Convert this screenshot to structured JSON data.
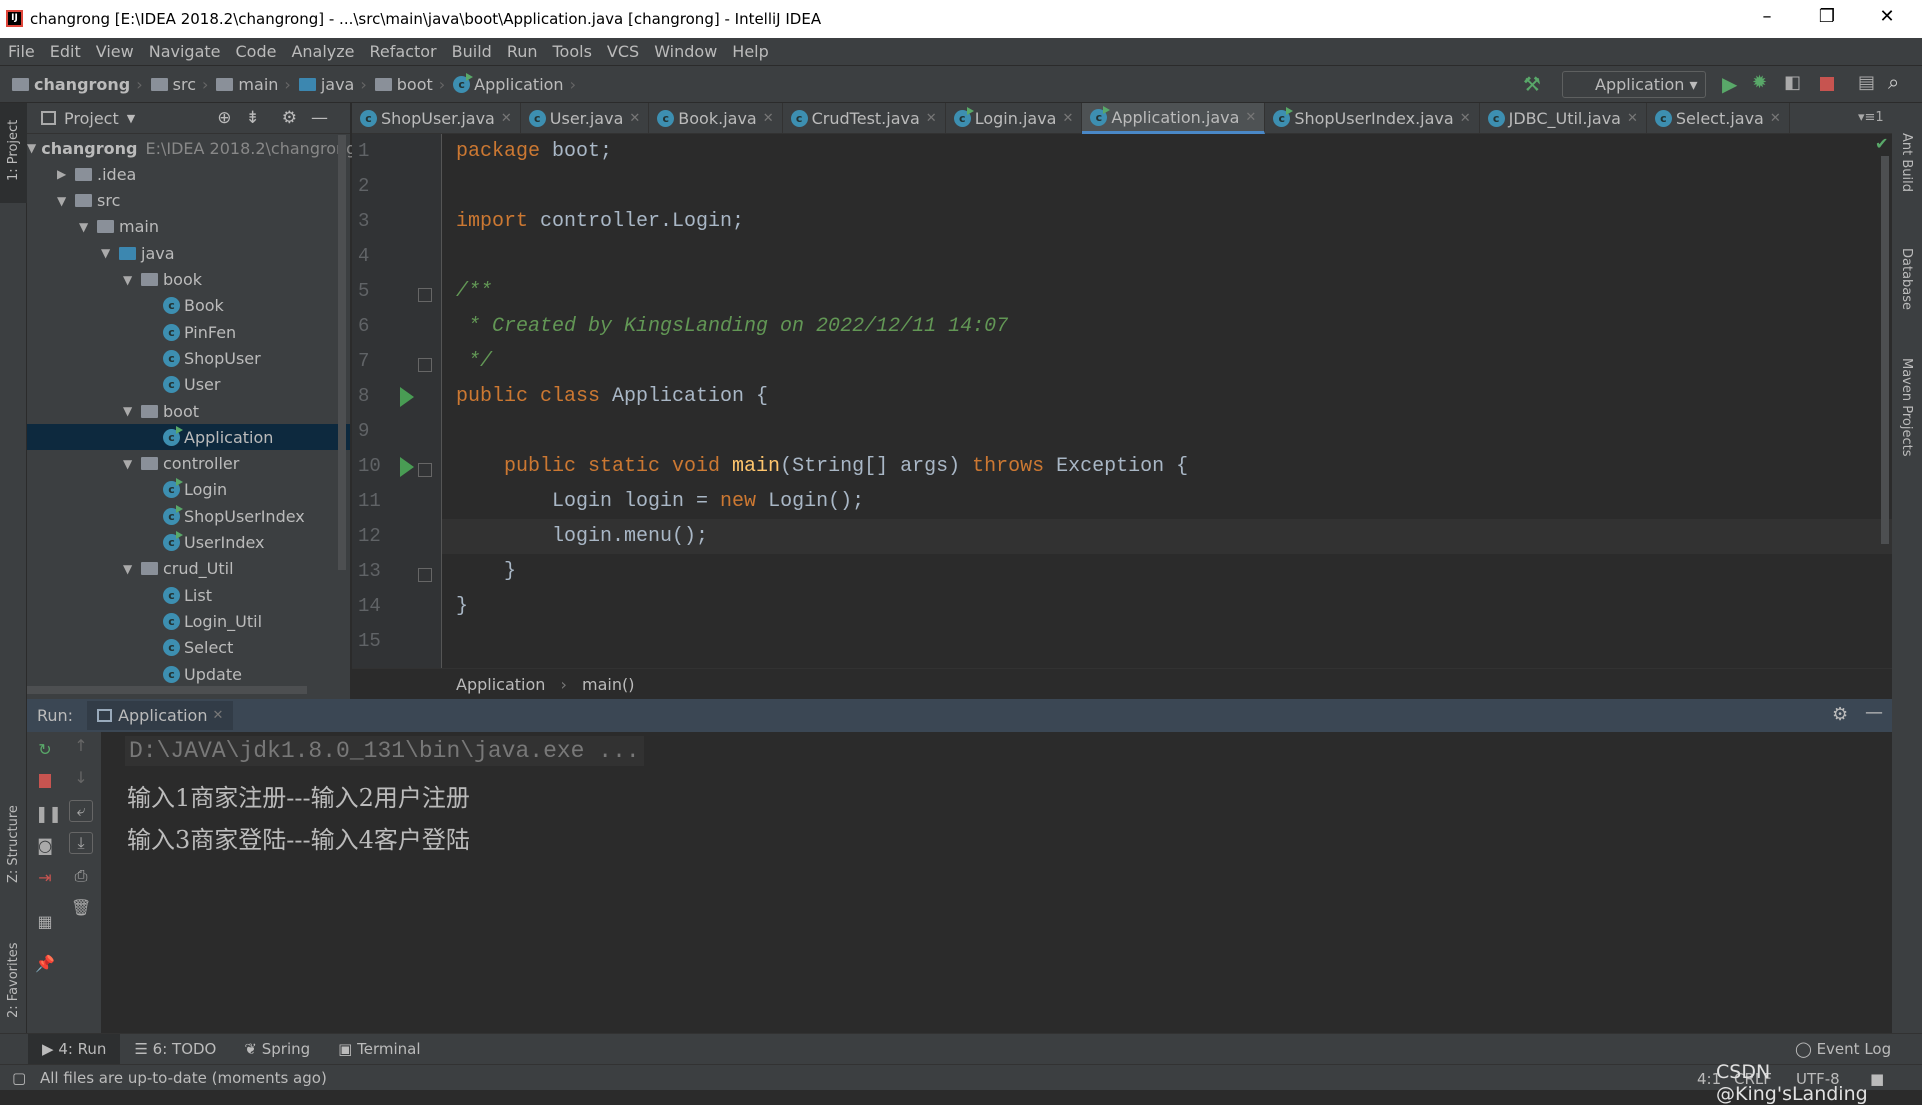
{
  "window": {
    "title": "changrong [E:\\IDEA 2018.2\\changrong] - ...\\src\\main\\java\\boot\\Application.java [changrong] - IntelliJ IDEA",
    "logo": "IJ"
  },
  "menu": [
    "File",
    "Edit",
    "View",
    "Navigate",
    "Code",
    "Analyze",
    "Refactor",
    "Build",
    "Run",
    "Tools",
    "VCS",
    "Window",
    "Help"
  ],
  "breadcrumb": [
    "changrong",
    "src",
    "main",
    "java",
    "boot",
    "Application"
  ],
  "run_config": "Application",
  "project": {
    "header": "Project",
    "root_path": "E:\\IDEA 2018.2\\changrong",
    "tree": [
      {
        "label": "changrong",
        "level": 0,
        "type": "module",
        "open": true
      },
      {
        "label": ".idea",
        "level": 1,
        "type": "folder",
        "open": false
      },
      {
        "label": "src",
        "level": 1,
        "type": "folder",
        "open": true
      },
      {
        "label": "main",
        "level": 2,
        "type": "folder",
        "open": true
      },
      {
        "label": "java",
        "level": 3,
        "type": "src",
        "open": true
      },
      {
        "label": "book",
        "level": 4,
        "type": "package",
        "open": true
      },
      {
        "label": "Book",
        "level": 5,
        "type": "class"
      },
      {
        "label": "PinFen",
        "level": 5,
        "type": "class"
      },
      {
        "label": "ShopUser",
        "level": 5,
        "type": "class"
      },
      {
        "label": "User",
        "level": 5,
        "type": "class"
      },
      {
        "label": "boot",
        "level": 4,
        "type": "package",
        "open": true
      },
      {
        "label": "Application",
        "level": 5,
        "type": "runclass",
        "selected": true
      },
      {
        "label": "controller",
        "level": 4,
        "type": "package",
        "open": true
      },
      {
        "label": "Login",
        "level": 5,
        "type": "runclass"
      },
      {
        "label": "ShopUserIndex",
        "level": 5,
        "type": "runclass"
      },
      {
        "label": "UserIndex",
        "level": 5,
        "type": "runclass"
      },
      {
        "label": "crud_Util",
        "level": 4,
        "type": "package",
        "open": true
      },
      {
        "label": "List",
        "level": 5,
        "type": "class"
      },
      {
        "label": "Login_Util",
        "level": 5,
        "type": "class"
      },
      {
        "label": "Select",
        "level": 5,
        "type": "class"
      },
      {
        "label": "Update",
        "level": 5,
        "type": "class"
      }
    ]
  },
  "tabs": [
    {
      "label": "ShopUser.java"
    },
    {
      "label": "User.java"
    },
    {
      "label": "Book.java"
    },
    {
      "label": "CrudTest.java"
    },
    {
      "label": "Login.java"
    },
    {
      "label": "Application.java",
      "active": true
    },
    {
      "label": "ShopUserIndex.java"
    },
    {
      "label": "JDBC_Util.java"
    },
    {
      "label": "Select.java"
    }
  ],
  "tabs_overflow": "1",
  "code": [
    [
      [
        "kw",
        "package "
      ],
      [
        "",
        "boot;"
      ]
    ],
    [],
    [
      [
        "kw",
        "import "
      ],
      [
        "",
        "controller.Login;"
      ]
    ],
    [],
    [
      [
        "cm",
        "/**"
      ]
    ],
    [
      [
        "cm",
        " * Created by KingsLanding on 2022/12/11 14:07"
      ]
    ],
    [
      [
        "cm",
        " */"
      ]
    ],
    [
      [
        "kw",
        "public class "
      ],
      [
        "",
        "Application {"
      ]
    ],
    [],
    [
      [
        "kw",
        "    public static void "
      ],
      [
        "fn",
        "main"
      ],
      [
        "",
        "(String[] args) "
      ],
      [
        "kw",
        "throws "
      ],
      [
        "",
        "Exception {"
      ]
    ],
    [
      [
        "",
        "        Login login = "
      ],
      [
        "kw",
        "new "
      ],
      [
        "",
        "Login();"
      ]
    ],
    [
      [
        "",
        "        login.menu();"
      ]
    ],
    [
      [
        "",
        "    }"
      ]
    ],
    [
      [
        "",
        "}"
      ]
    ],
    []
  ],
  "editor_breadcrumb": [
    "Application",
    "main()"
  ],
  "run": {
    "label": "Run:",
    "tab": "Application",
    "console": [
      "D:\\JAVA\\jdk1.8.0_131\\bin\\java.exe ...",
      "输入1商家注册---输入2用户注册",
      "输入3商家登陆---输入4客户登陆"
    ]
  },
  "left_stripe": [
    "1: Project",
    "Z: Structure",
    "2: Favorites"
  ],
  "right_stripe": [
    "Ant Build",
    "Database",
    "Maven Projects"
  ],
  "bottom_tabs": [
    "4: Run",
    "6: TODO",
    "Spring",
    "Terminal"
  ],
  "event_log": "Event Log",
  "status": {
    "message": "All files are up-to-date (moments ago)",
    "position": "4:1",
    "line_sep": "CRLF",
    "encoding": "UTF-8",
    "watermark": "CSDN @King'sLanding"
  }
}
